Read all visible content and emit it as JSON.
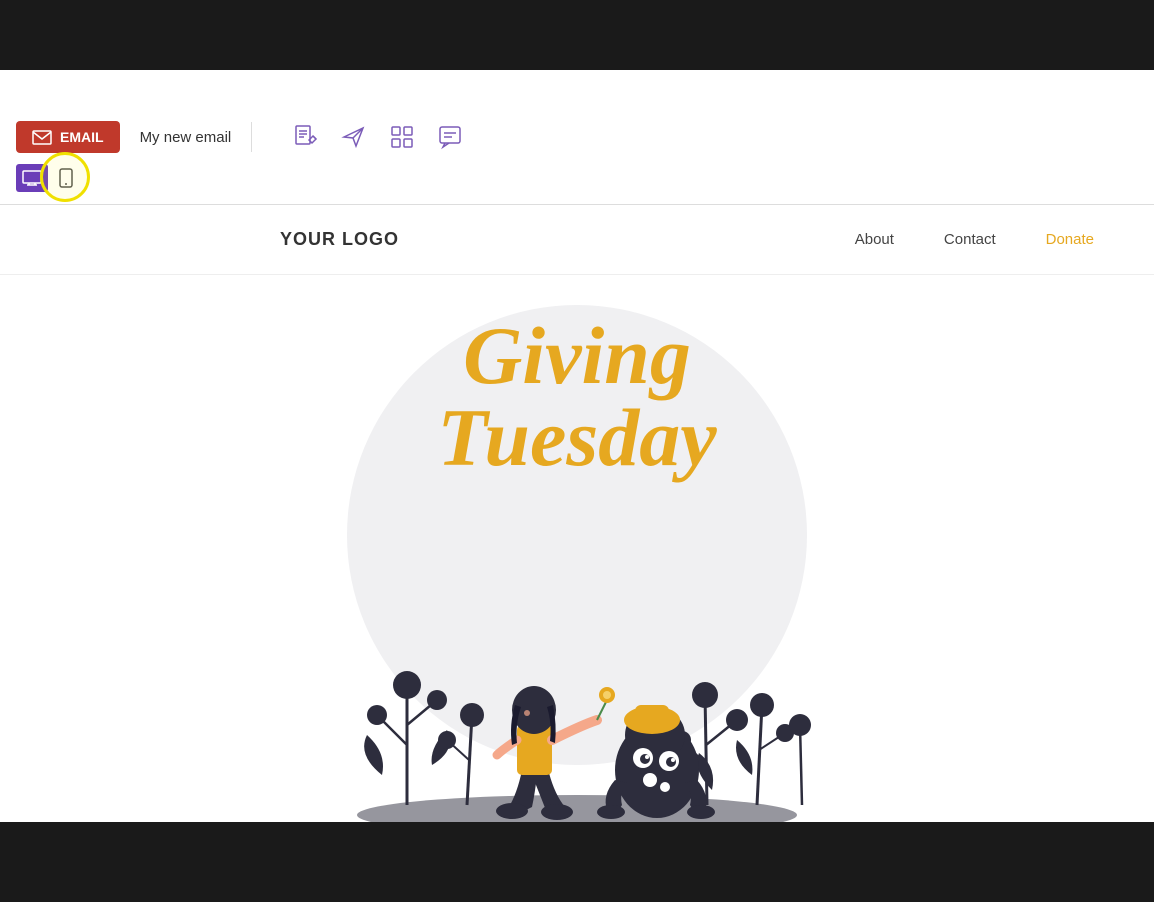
{
  "top_bar": {},
  "toolbar": {
    "email_button_label": "EMAIL",
    "email_name": "My new email",
    "icons": [
      {
        "name": "document-edit-icon",
        "symbol": "📋"
      },
      {
        "name": "send-icon",
        "symbol": "✈"
      },
      {
        "name": "grid-icon",
        "symbol": "⊞"
      },
      {
        "name": "chat-icon",
        "symbol": "💬"
      }
    ]
  },
  "device_switcher": {
    "desktop_label": "Desktop",
    "mobile_label": "Mobile"
  },
  "preview": {
    "logo": "YOUR LOGO",
    "nav": {
      "about": "About",
      "contact": "Contact",
      "donate": "Donate"
    },
    "hero_title_line1": "Giving",
    "hero_title_line2": "Tuesday",
    "colors": {
      "donate_color": "#e6a820",
      "hero_title_color": "#e6a820",
      "bg_circle": "#f0f0f2"
    }
  }
}
